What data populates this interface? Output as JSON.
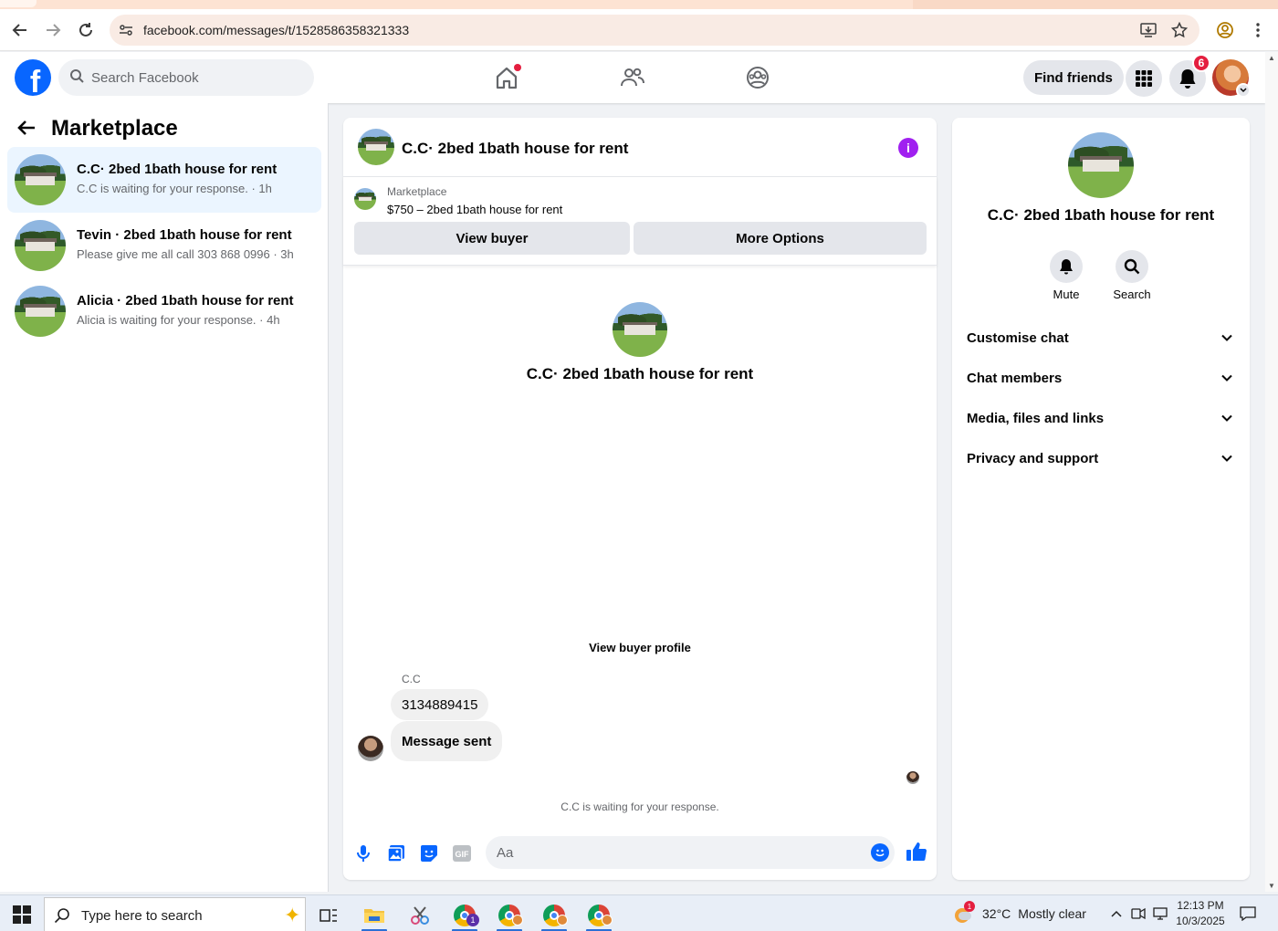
{
  "browser": {
    "url": "facebook.com/messages/t/1528586358321333"
  },
  "header": {
    "search_placeholder": "Search Facebook",
    "find_friends_label": "Find friends",
    "notification_count": "6"
  },
  "left_panel": {
    "title": "Marketplace",
    "conversations": [
      {
        "title": "C.C· 2bed 1bath house for rent",
        "subtitle": "C.C is waiting for your response. · 1h",
        "active": true
      },
      {
        "title": "Tevin · 2bed 1bath house for rent",
        "subtitle": "Please give me all call 303 868 0996 · 3h",
        "active": false
      },
      {
        "title": "Alicia · 2bed 1bath house for rent",
        "subtitle": "Alicia is waiting for your response. · 4h",
        "active": false
      }
    ]
  },
  "chat": {
    "title": "C.C· 2bed 1bath house for rent",
    "marketplace_label": "Marketplace",
    "listing": "$750 – 2bed 1bath house for rent",
    "view_buyer_label": "View buyer",
    "more_options_label": "More Options",
    "center_title": "C.C· 2bed 1bath house for rent",
    "view_buyer_profile_label": "View buyer profile",
    "sender_name": "C.C",
    "messages": [
      "3134889415",
      "Message sent"
    ],
    "status": "C.C is waiting for your response.",
    "composer_placeholder": "Aa"
  },
  "right_panel": {
    "title": "C.C· 2bed 1bath house for rent",
    "mute_label": "Mute",
    "search_label": "Search",
    "sections": [
      "Customise chat",
      "Chat members",
      "Media, files and links",
      "Privacy and support"
    ]
  },
  "taskbar": {
    "search_text": "Type here to search",
    "weather_temp": "32°C",
    "weather_desc": "Mostly clear",
    "weather_badge": "1",
    "chrome_badge": "1",
    "time": "12:13 PM",
    "date": "10/3/2025"
  },
  "colors": {
    "facebook_blue": "#0866ff",
    "active_conversation_bg": "#ebf5ff",
    "info_purple": "#a020f0",
    "notification_red": "#e41e3f"
  }
}
